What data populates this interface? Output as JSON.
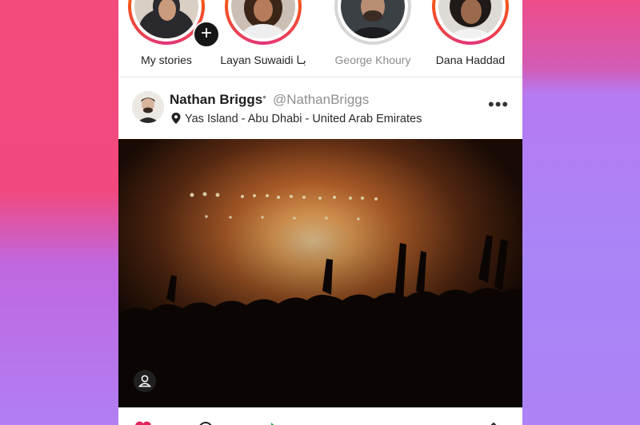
{
  "stories": [
    {
      "name": "My stories",
      "seen": false,
      "has_add": true
    },
    {
      "name": "Layan Suwaidi بـا",
      "seen": false
    },
    {
      "name": "George Khoury",
      "seen": true
    },
    {
      "name": "Dana Haddad",
      "seen": false
    }
  ],
  "post": {
    "author_name": "Nathan Briggs",
    "separator": "•",
    "handle": "@NathanBriggs",
    "location": "Yas Island - Abu Dhabi - United Arab Emirates",
    "more_icon": "more-horizontal-icon",
    "image_description": "concert-crowd-photo"
  },
  "colors": {
    "story_ring_gradient": [
      "#f5b300",
      "#f5501f",
      "#e3347e"
    ],
    "story_ring_seen": "#d6d6d6",
    "background_pink": "#f34b7b",
    "background_purple": "#b07cf2",
    "like_red": "#e0245e",
    "share_green": "#22b14c"
  }
}
